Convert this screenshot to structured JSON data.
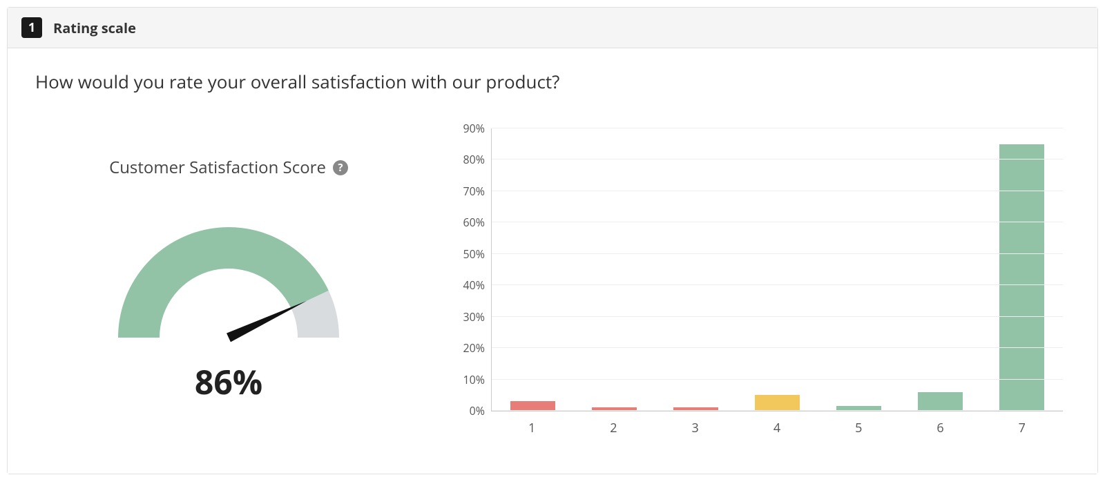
{
  "header": {
    "question_number": "1",
    "question_type": "Rating scale"
  },
  "question": "How would you rate your overall satisfaction with our product?",
  "gauge": {
    "title": "Customer Satisfaction Score",
    "help_glyph": "?",
    "value_pct": 86,
    "value_label": "86%",
    "colors": {
      "fill": "#93C3A7",
      "track": "#D9DCDE",
      "needle": "#111111"
    }
  },
  "chart_data": {
    "type": "bar",
    "categories": [
      "1",
      "2",
      "3",
      "4",
      "5",
      "6",
      "7"
    ],
    "values": [
      3,
      1,
      1,
      5,
      1.5,
      6,
      85
    ],
    "bar_colors": [
      "#E77D77",
      "#E77D77",
      "#E77D77",
      "#F2C75C",
      "#93C3A7",
      "#93C3A7",
      "#93C3A7"
    ],
    "y_ticks": [
      0,
      10,
      20,
      30,
      40,
      50,
      60,
      70,
      80,
      90
    ],
    "y_tick_labels": [
      "0%",
      "10%",
      "20%",
      "30%",
      "40%",
      "50%",
      "60%",
      "70%",
      "80%",
      "90%"
    ],
    "ylim": [
      0,
      90
    ],
    "xlabel": "",
    "ylabel": "",
    "title": ""
  }
}
